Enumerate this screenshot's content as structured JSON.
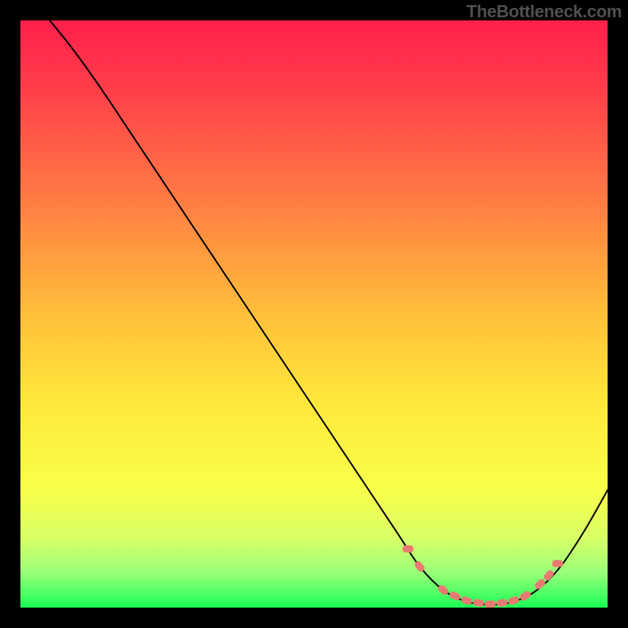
{
  "watermark": "TheBottleneck.com",
  "chart_data": {
    "type": "line",
    "title": "",
    "xlabel": "",
    "ylabel": "",
    "xlim": [
      0,
      100
    ],
    "ylim": [
      0,
      100
    ],
    "gradient_stops": [
      {
        "offset": 0,
        "color": "#ff1f4b"
      },
      {
        "offset": 12,
        "color": "#ff3f4a"
      },
      {
        "offset": 30,
        "color": "#ff7a44"
      },
      {
        "offset": 50,
        "color": "#ffbf3a"
      },
      {
        "offset": 65,
        "color": "#ffe83a"
      },
      {
        "offset": 80,
        "color": "#f8ff4a"
      },
      {
        "offset": 88,
        "color": "#d9ff66"
      },
      {
        "offset": 94,
        "color": "#9bff7a"
      },
      {
        "offset": 100,
        "color": "#1aff55"
      }
    ],
    "series": [
      {
        "name": "bottleneck-curve",
        "type": "line",
        "color": "#000000",
        "width": 2,
        "points": [
          {
            "x": 5,
            "y": 100
          },
          {
            "x": 9,
            "y": 95
          },
          {
            "x": 14,
            "y": 88
          },
          {
            "x": 20,
            "y": 79
          },
          {
            "x": 30,
            "y": 64
          },
          {
            "x": 40,
            "y": 49
          },
          {
            "x": 50,
            "y": 34
          },
          {
            "x": 58,
            "y": 22
          },
          {
            "x": 64,
            "y": 13
          },
          {
            "x": 68,
            "y": 7
          },
          {
            "x": 72,
            "y": 3
          },
          {
            "x": 76,
            "y": 1
          },
          {
            "x": 80,
            "y": 0.5
          },
          {
            "x": 84,
            "y": 1
          },
          {
            "x": 88,
            "y": 3
          },
          {
            "x": 92,
            "y": 7
          },
          {
            "x": 96,
            "y": 13
          },
          {
            "x": 100,
            "y": 20
          }
        ]
      },
      {
        "name": "optimal-region-markers",
        "type": "scatter",
        "color": "#e87a72",
        "size": 5,
        "points": [
          {
            "x": 66,
            "y": 10
          },
          {
            "x": 68,
            "y": 7
          },
          {
            "x": 72,
            "y": 3
          },
          {
            "x": 74,
            "y": 2
          },
          {
            "x": 76,
            "y": 1.2
          },
          {
            "x": 78,
            "y": 0.8
          },
          {
            "x": 80,
            "y": 0.6
          },
          {
            "x": 82,
            "y": 0.8
          },
          {
            "x": 84,
            "y": 1.2
          },
          {
            "x": 86,
            "y": 2
          },
          {
            "x": 88.5,
            "y": 4
          },
          {
            "x": 90,
            "y": 5.5
          },
          {
            "x": 91.5,
            "y": 7.5
          }
        ]
      }
    ]
  }
}
